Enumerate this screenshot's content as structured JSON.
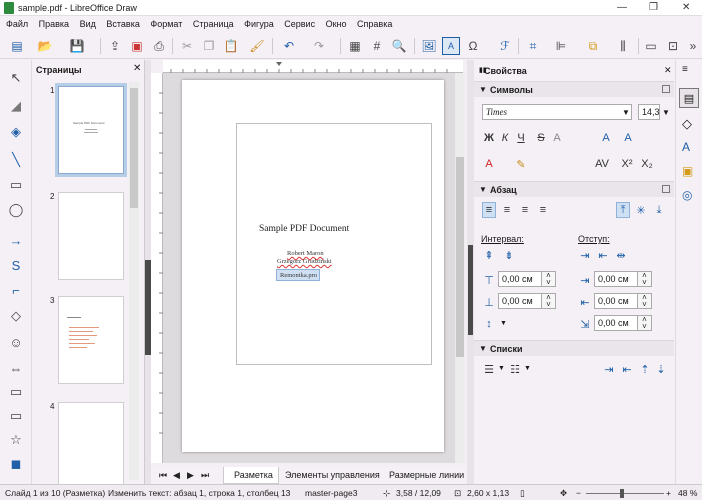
{
  "window": {
    "title": "sample.pdf - LibreOffice Draw",
    "controls": [
      "—",
      "❐",
      "✕"
    ]
  },
  "menu": [
    "Файл",
    "Правка",
    "Вид",
    "Вставка",
    "Формат",
    "Страница",
    "Фигура",
    "Сервис",
    "Окно",
    "Справка"
  ],
  "pages_panel": {
    "title": "Страницы",
    "pages": [
      "1",
      "2",
      "3",
      "4"
    ],
    "thumb1_title": "Sample PDF Document"
  },
  "document": {
    "heading": "Sample PDF Document",
    "author1": "Robert Maron",
    "author2": "Grzegorz Grudziński",
    "selected_text": "Remontka.pro"
  },
  "tabs": [
    "Разметка",
    "Элементы управления",
    "Размерные линии"
  ],
  "sidebar": {
    "title": "Свойства",
    "char_section": "Символы",
    "font_name": "Times",
    "font_size": "14,3",
    "para_section": "Абзац",
    "spacing_label": "Интервал:",
    "indent_label": "Отступ:",
    "spacing_above": "0,00 см",
    "spacing_below": "0,00 см",
    "indent_before": "0,00 см",
    "indent_after": "0,00 см",
    "indent_first": "0,00 см",
    "lists_section": "Списки"
  },
  "status": {
    "slide": "Слайд 1 из 10 (Разметка)",
    "edit": "Изменить текст: абзац 1, строка 1, столбец 13",
    "master": "master-page3",
    "pos": "3,58 / 12,09",
    "size": "2,60 x 1,13",
    "zoom": "48 %"
  },
  "colors": {
    "accent": "#1f5fa8",
    "selection": "#b6cde6"
  }
}
